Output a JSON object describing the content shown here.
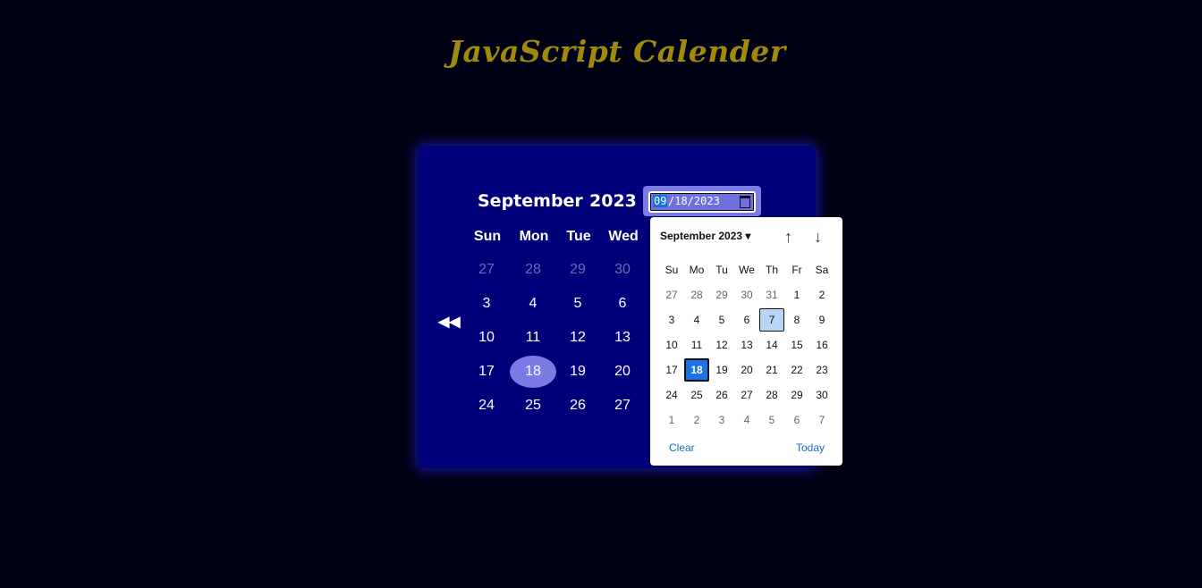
{
  "page": {
    "title": "JavaScript Calender"
  },
  "calendar": {
    "month": "September",
    "year": "2023",
    "prev_icon": "double-chevron-left-icon",
    "weekdays": [
      "Sun",
      "Mon",
      "Tue",
      "Wed"
    ],
    "rows": [
      [
        "27",
        "28",
        "29",
        "30"
      ],
      [
        "3",
        "4",
        "5",
        "6"
      ],
      [
        "10",
        "11",
        "12",
        "13"
      ],
      [
        "17",
        "18",
        "19",
        "20"
      ],
      [
        "24",
        "25",
        "26",
        "27"
      ]
    ],
    "today": "18",
    "accent_color": "#7b7be6",
    "background_color": "#00007a"
  },
  "date_input": {
    "month_part": "09",
    "rest": "/18/2023",
    "icon": "calendar-icon"
  },
  "picker": {
    "month_label": "September 2023 ▾",
    "up_icon": "arrow-up-icon",
    "down_icon": "arrow-down-icon",
    "weekdays": [
      "Su",
      "Mo",
      "Tu",
      "We",
      "Th",
      "Fr",
      "Sa"
    ],
    "rows": [
      [
        "27",
        "28",
        "29",
        "30",
        "31",
        "1",
        "2"
      ],
      [
        "3",
        "4",
        "5",
        "6",
        "7",
        "8",
        "9"
      ],
      [
        "10",
        "11",
        "12",
        "13",
        "14",
        "15",
        "16"
      ],
      [
        "17",
        "18",
        "19",
        "20",
        "21",
        "22",
        "23"
      ],
      [
        "24",
        "25",
        "26",
        "27",
        "28",
        "29",
        "30"
      ],
      [
        "1",
        "2",
        "3",
        "4",
        "5",
        "6",
        "7"
      ]
    ],
    "selected": "18",
    "hovered": "7",
    "clear_label": "Clear",
    "today_label": "Today"
  }
}
